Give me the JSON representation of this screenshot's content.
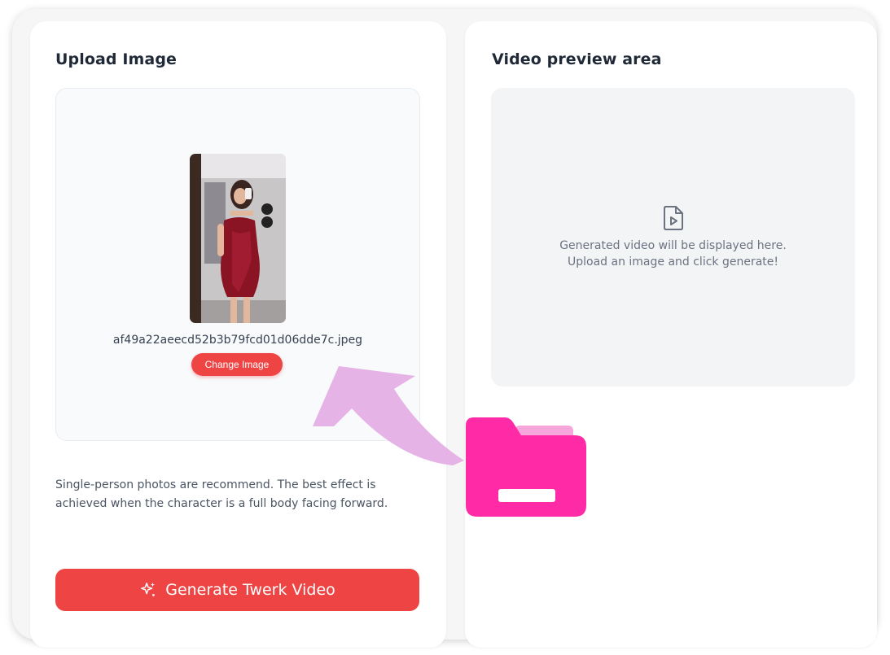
{
  "upload": {
    "title": "Upload Image",
    "filename": "af49a22aeecd52b3b79fcd01d06dde7c.jpeg",
    "change_label": "Change Image",
    "hint": "Single-person photos are recommend. The best effect is achieved when the character is a full body facing forward.",
    "generate_label": "Generate Twerk Video",
    "thumbnail_icon": "photo-thumbnail",
    "generate_icon": "sparkles-icon"
  },
  "preview": {
    "title": "Video preview area",
    "line1": "Generated video will be displayed here.",
    "line2": "Upload an image and click generate!",
    "icon": "video-file-icon"
  },
  "colors": {
    "accent": "#ef4444",
    "folder": "#ff2aa6",
    "arrow": "#e6b3e6"
  }
}
